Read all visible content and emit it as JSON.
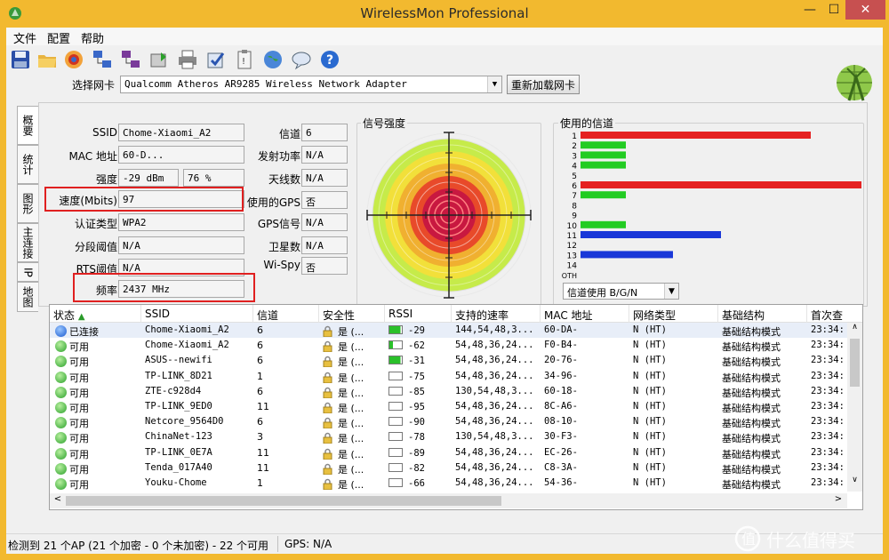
{
  "window": {
    "title": "WirelessMon Professional",
    "buttons": {
      "minimize": "—",
      "maximize": "☐",
      "close": "✕"
    }
  },
  "menu": [
    "文件",
    "配置",
    "帮助"
  ],
  "toolbar_icons": [
    "save-icon",
    "open-folder-icon",
    "record-icon",
    "network-icon",
    "network-config-icon",
    "export-icon",
    "print-icon",
    "check-icon",
    "clipboard-icon",
    "globe-icon",
    "chat-icon",
    "help-icon"
  ],
  "adapter": {
    "label": "选择网卡",
    "value": "Qualcomm Atheros AR9285 Wireless Network Adapter",
    "reload_button": "重新加载网卡"
  },
  "side_tabs": [
    "概要",
    "统计",
    "图形",
    "主连接",
    "IP",
    "地图"
  ],
  "info": {
    "ssid_label": "SSID",
    "ssid": "Chome-Xiaomi_A2",
    "mac_label": "MAC 地址",
    "mac": "60-D...",
    "strength_label": "强度",
    "strength_dbm": "-29 dBm",
    "strength_pct": "76 %",
    "speed_label": "速度(Mbits)",
    "speed": "97",
    "auth_label": "认证类型",
    "auth": "WPA2",
    "frag_label": "分段阈值",
    "frag": "N/A",
    "rts_label": "RTS阈值",
    "rts": "N/A",
    "freq_label": "频率",
    "freq": "2437 MHz",
    "channel_label": "信道",
    "channel": "6",
    "txpower_label": "发射功率",
    "txpower": "N/A",
    "antenna_label": "天线数",
    "antenna": "N/A",
    "gps_use_label": "使用的GPS",
    "gps_use": "否",
    "gps_signal_label": "GPS信号",
    "gps_signal": "N/A",
    "satellites_label": "卫星数",
    "satellites": "N/A",
    "wispy_label": "Wi-Spy",
    "wispy": "否"
  },
  "signal_panel": {
    "title": "信号强度"
  },
  "channels_panel": {
    "title": "使用的信道",
    "labels": [
      "1",
      "2",
      "3",
      "4",
      "5",
      "6",
      "7",
      "8",
      "9",
      "10",
      "11",
      "12",
      "13",
      "14",
      "OTH"
    ],
    "bars": [
      [
        {
          "color": "#e52222",
          "value": 0.82
        }
      ],
      [
        {
          "color": "#22cc22",
          "value": 0.16
        }
      ],
      [
        {
          "color": "#22cc22",
          "value": 0.16
        }
      ],
      [
        {
          "color": "#22cc22",
          "value": 0.16
        }
      ],
      [],
      [
        {
          "color": "#e52222",
          "value": 1.0
        }
      ],
      [
        {
          "color": "#22cc22",
          "value": 0.16
        }
      ],
      [],
      [],
      [
        {
          "color": "#22cc22",
          "value": 0.16
        }
      ],
      [
        {
          "color": "#1a38d8",
          "value": 0.5
        }
      ],
      [],
      [
        {
          "color": "#1a38d8",
          "value": 0.33
        }
      ],
      [],
      []
    ],
    "mode_select": "信道使用 B/G/N"
  },
  "list": {
    "headers": [
      "状态",
      "SSID",
      "信道",
      "安全性",
      "RSSI",
      "支持的速率",
      "MAC 地址",
      "网络类型",
      "基础结构",
      "首次查"
    ],
    "rows": [
      {
        "status": "已连接",
        "icon": "blue",
        "ssid": "Chome-Xiaomi_A2",
        "ch": "6",
        "sec": "是 (...",
        "rssi_pct": 0.9,
        "rssi": "-29",
        "rates": "144,54,48,3...",
        "mac": "60-DA-",
        "type": "N (HT)",
        "infra": "基础结构模式",
        "first": "23:34:"
      },
      {
        "status": "可用",
        "icon": "green",
        "ssid": "Chome-Xiaomi_A2",
        "ch": "6",
        "sec": "是 (...",
        "rssi_pct": 0.3,
        "rssi": "-62",
        "rates": "54,48,36,24...",
        "mac": "F0-B4-",
        "type": "N (HT)",
        "infra": "基础结构模式",
        "first": "23:34:"
      },
      {
        "status": "可用",
        "icon": "green",
        "ssid": "ASUS--newifi",
        "ch": "6",
        "sec": "是 (...",
        "rssi_pct": 0.9,
        "rssi": "-31",
        "rates": "54,48,36,24...",
        "mac": "20-76-",
        "type": "N (HT)",
        "infra": "基础结构模式",
        "first": "23:34:"
      },
      {
        "status": "可用",
        "icon": "green",
        "ssid": "TP-LINK_8D21",
        "ch": "1",
        "sec": "是 (...",
        "rssi_pct": 0.0,
        "rssi": "-75",
        "rates": "54,48,36,24...",
        "mac": "34-96-",
        "type": "N (HT)",
        "infra": "基础结构模式",
        "first": "23:34:"
      },
      {
        "status": "可用",
        "icon": "green",
        "ssid": "ZTE-c928d4",
        "ch": "6",
        "sec": "是 (...",
        "rssi_pct": 0.0,
        "rssi": "-85",
        "rates": "130,54,48,3...",
        "mac": "60-18-",
        "type": "N (HT)",
        "infra": "基础结构模式",
        "first": "23:34:"
      },
      {
        "status": "可用",
        "icon": "green",
        "ssid": "TP-LINK_9ED0",
        "ch": "11",
        "sec": "是 (...",
        "rssi_pct": 0.0,
        "rssi": "-95",
        "rates": "54,48,36,24...",
        "mac": "8C-A6-",
        "type": "N (HT)",
        "infra": "基础结构模式",
        "first": "23:34:"
      },
      {
        "status": "可用",
        "icon": "green",
        "ssid": "Netcore_9564D0",
        "ch": "6",
        "sec": "是 (...",
        "rssi_pct": 0.0,
        "rssi": "-90",
        "rates": "54,48,36,24...",
        "mac": "08-10-",
        "type": "N (HT)",
        "infra": "基础结构模式",
        "first": "23:34:"
      },
      {
        "status": "可用",
        "icon": "green",
        "ssid": "ChinaNet-123",
        "ch": "3",
        "sec": "是 (...",
        "rssi_pct": 0.0,
        "rssi": "-78",
        "rates": "130,54,48,3...",
        "mac": "30-F3-",
        "type": "N (HT)",
        "infra": "基础结构模式",
        "first": "23:34:"
      },
      {
        "status": "可用",
        "icon": "green",
        "ssid": "TP-LINK_0E7A",
        "ch": "11",
        "sec": "是 (...",
        "rssi_pct": 0.0,
        "rssi": "-89",
        "rates": "54,48,36,24...",
        "mac": "EC-26-",
        "type": "N (HT)",
        "infra": "基础结构模式",
        "first": "23:34:"
      },
      {
        "status": "可用",
        "icon": "green",
        "ssid": "Tenda_017A40",
        "ch": "11",
        "sec": "是 (...",
        "rssi_pct": 0.0,
        "rssi": "-82",
        "rates": "54,48,36,24...",
        "mac": "C8-3A-",
        "type": "N (HT)",
        "infra": "基础结构模式",
        "first": "23:34:"
      },
      {
        "status": "可用",
        "icon": "green",
        "ssid": "Youku-Chome",
        "ch": "1",
        "sec": "是 (...",
        "rssi_pct": 0.0,
        "rssi": "-66",
        "rates": "54,48,36,24...",
        "mac": "54-36-",
        "type": "N (HT)",
        "infra": "基础结构模式",
        "first": "23:34:"
      }
    ]
  },
  "statusbar": {
    "left": "检测到 21 个AP (21 个加密 - 0 个未加密) - 22 个可用",
    "gps": "GPS: N/A"
  },
  "watermark": "什么值得买"
}
